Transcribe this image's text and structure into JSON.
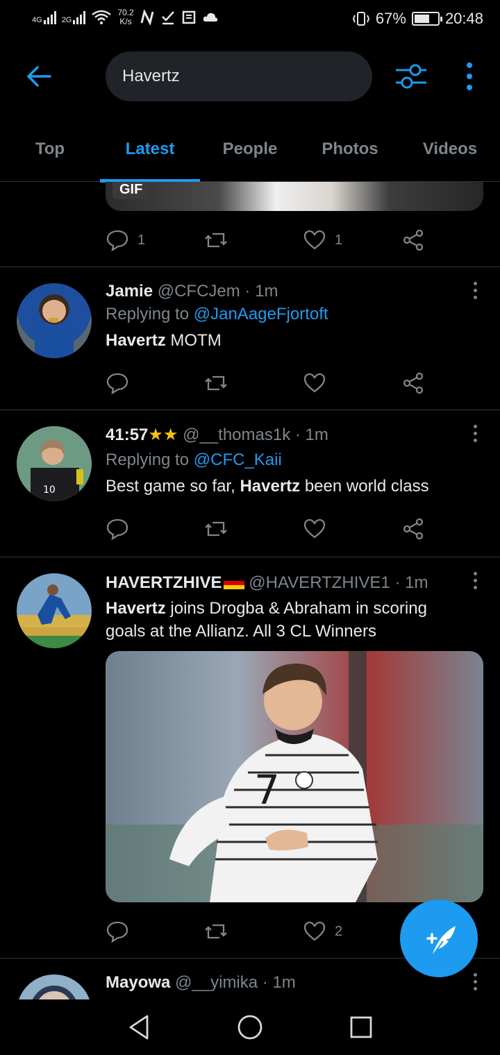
{
  "status": {
    "network1": "4G",
    "network2": "2G",
    "speed_value": "70.2",
    "speed_unit": "K/s",
    "battery": "67%",
    "battery_level": 0.67,
    "time": "20:48"
  },
  "header": {
    "search_value": "Havertz"
  },
  "tabs": [
    {
      "label": "Top"
    },
    {
      "label": "Latest"
    },
    {
      "label": "People"
    },
    {
      "label": "Photos"
    },
    {
      "label": "Videos"
    }
  ],
  "prev_tweet": {
    "gif_badge": "GIF",
    "replies": "1",
    "likes": "1"
  },
  "tweets": [
    {
      "name": "Jamie",
      "handle": "@CFCJem · 1m",
      "replying_prefix": "Replying to ",
      "replying_to": "@JanAageFjortoft",
      "text_bold": "Havertz",
      "text_rest": " MOTM"
    },
    {
      "name": "41:57",
      "name_stars": "★★",
      "handle": "@__thomas1k · 1m",
      "replying_prefix": "Replying to ",
      "replying_to": "@CFC_Kaii",
      "text_pre": "Best game so far, ",
      "text_bold": "Havertz",
      "text_rest": " been world class"
    },
    {
      "name": "HAVERTZHIVE",
      "handle": "@HAVERTZHIVE1 · 1m",
      "text_bold": "Havertz",
      "text_rest1": " joins Drogba & Abraham in scoring",
      "text_line2": "goals at the Allianz. All 3 CL Winners",
      "likes": "2"
    },
    {
      "name": "Mayowa",
      "handle": "@__yimika · 1m"
    }
  ],
  "colors": {
    "accent": "#1d9bf0",
    "muted": "#7e868c",
    "background": "#000000"
  }
}
